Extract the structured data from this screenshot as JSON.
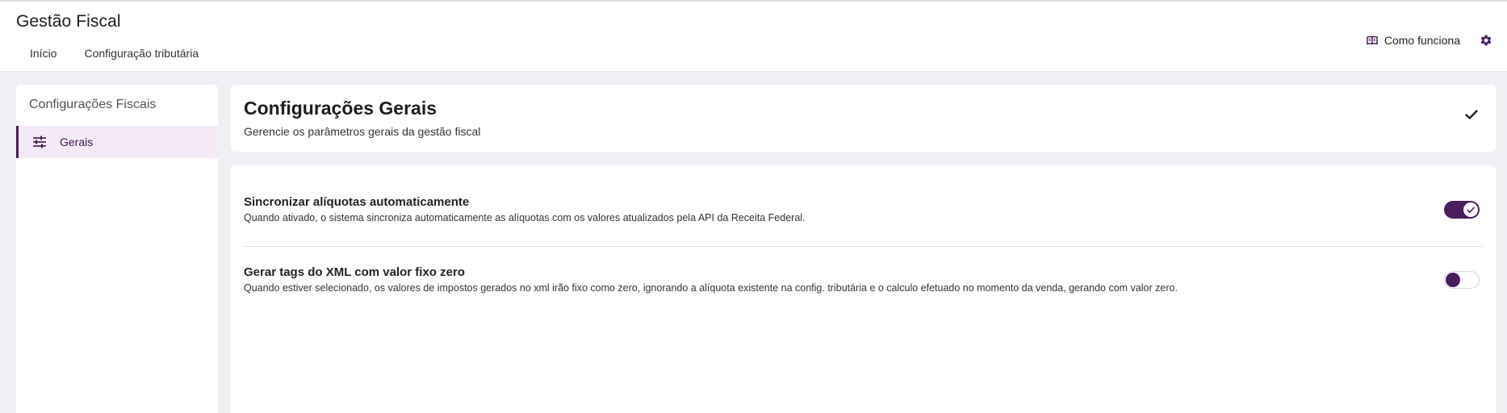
{
  "header": {
    "app_title": "Gestão Fiscal",
    "nav": [
      {
        "label": "Início"
      },
      {
        "label": "Configuração tributária"
      }
    ],
    "how_it_works_label": "Como funciona",
    "icons": {
      "book": "book-icon",
      "settings": "gear-icon"
    },
    "accent_color": "#4a1d5f"
  },
  "sidebar": {
    "title": "Configurações Fiscais",
    "items": [
      {
        "label": "Gerais",
        "icon": "sliders-icon",
        "active": true
      }
    ]
  },
  "main": {
    "title": "Configurações Gerais",
    "subtitle": "Gerencie os parâmetros gerais da gestão fiscal",
    "confirm_icon": "check-icon",
    "settings": [
      {
        "title": "Sincronizar alíquotas automaticamente",
        "description": "Quando ativado, o sistema sincroniza automaticamente as alíquotas com os valores atualizados pela API da Receita Federal.",
        "enabled": true
      },
      {
        "title": "Gerar tags do XML com valor fixo zero",
        "description": "Quando estiver selecionado, os valores de impostos gerados no xml irão fixo como zero, ignorando a alíquota existente na config. tributária e o calculo efetuado no momento da venda, gerando com valor zero.",
        "enabled": false
      }
    ]
  }
}
